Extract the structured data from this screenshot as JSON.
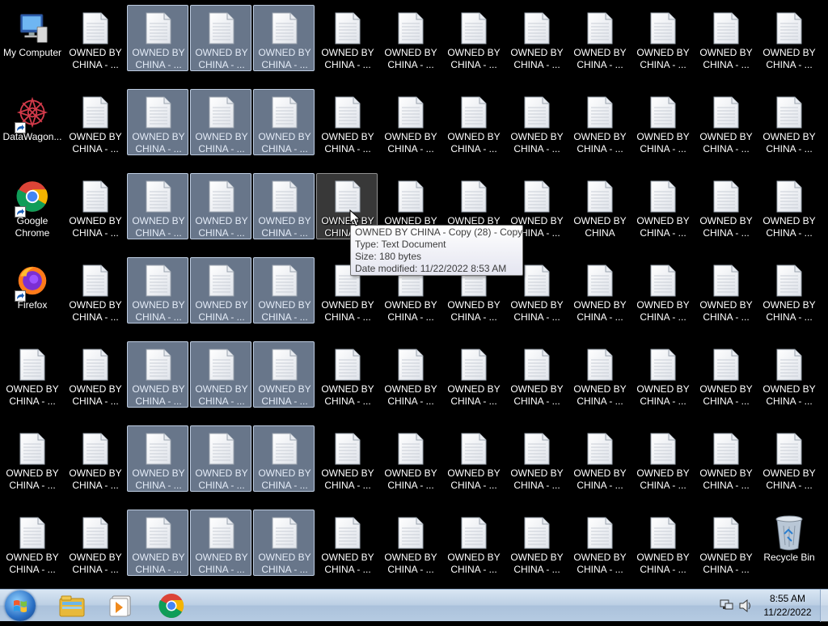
{
  "desktop": {
    "file_icon_name": "text-document-icon",
    "file_label": [
      "OWNED BY",
      "CHINA - ..."
    ],
    "full_label": [
      "OWNED BY",
      "CHINA"
    ],
    "shortcuts": {
      "my_computer": "My Computer",
      "datawagon": "DataWagon...",
      "chrome": [
        "Google",
        "Chrome"
      ],
      "firefox": "Firefox",
      "recycle_bin": "Recycle Bin"
    },
    "selection_color": "#a8bede"
  },
  "tooltip": {
    "name": "OWNED BY CHINA - Copy (28) - Copy",
    "type": "Type: Text Document",
    "size": "Size: 180 bytes",
    "modified": "Date modified: 11/22/2022 8:53 AM"
  },
  "taskbar": {
    "pinned": [
      "windows-explorer-icon",
      "media-player-icon",
      "chrome-icon"
    ],
    "time": "8:55 AM",
    "date": "11/22/2022",
    "tray_icons": [
      "network-icon",
      "volume-icon"
    ]
  }
}
